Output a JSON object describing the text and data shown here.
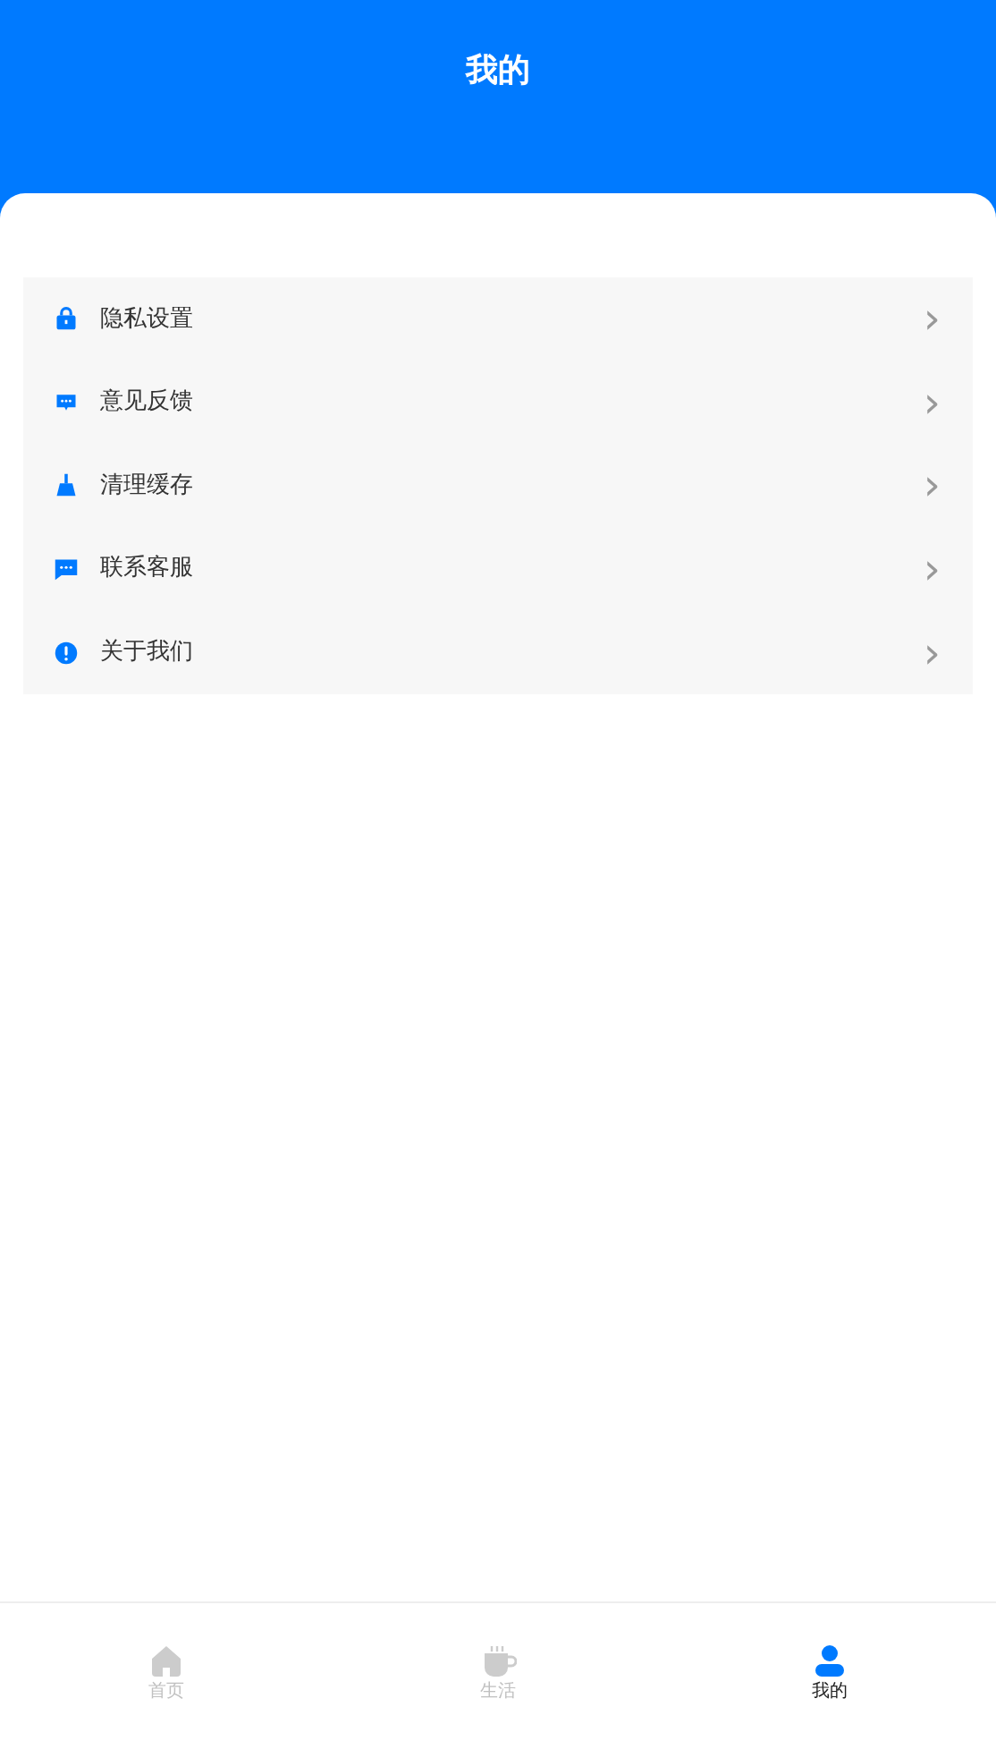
{
  "header": {
    "title": "我的"
  },
  "menu": [
    {
      "kind": "lock",
      "label": "隐私设置",
      "chevron": "›"
    },
    {
      "kind": "feedback",
      "label": "意见反馈",
      "chevron": "›"
    },
    {
      "kind": "broom",
      "label": "清理缓存",
      "chevron": "›"
    },
    {
      "kind": "chat",
      "label": "联系客服",
      "chevron": "›"
    },
    {
      "kind": "info",
      "label": "关于我们",
      "chevron": "›"
    }
  ],
  "tabbar": [
    {
      "kind": "home",
      "label": "首页",
      "selected": false
    },
    {
      "kind": "cup",
      "label": "生活",
      "selected": false
    },
    {
      "kind": "person",
      "label": "我的",
      "selected": true
    }
  ]
}
